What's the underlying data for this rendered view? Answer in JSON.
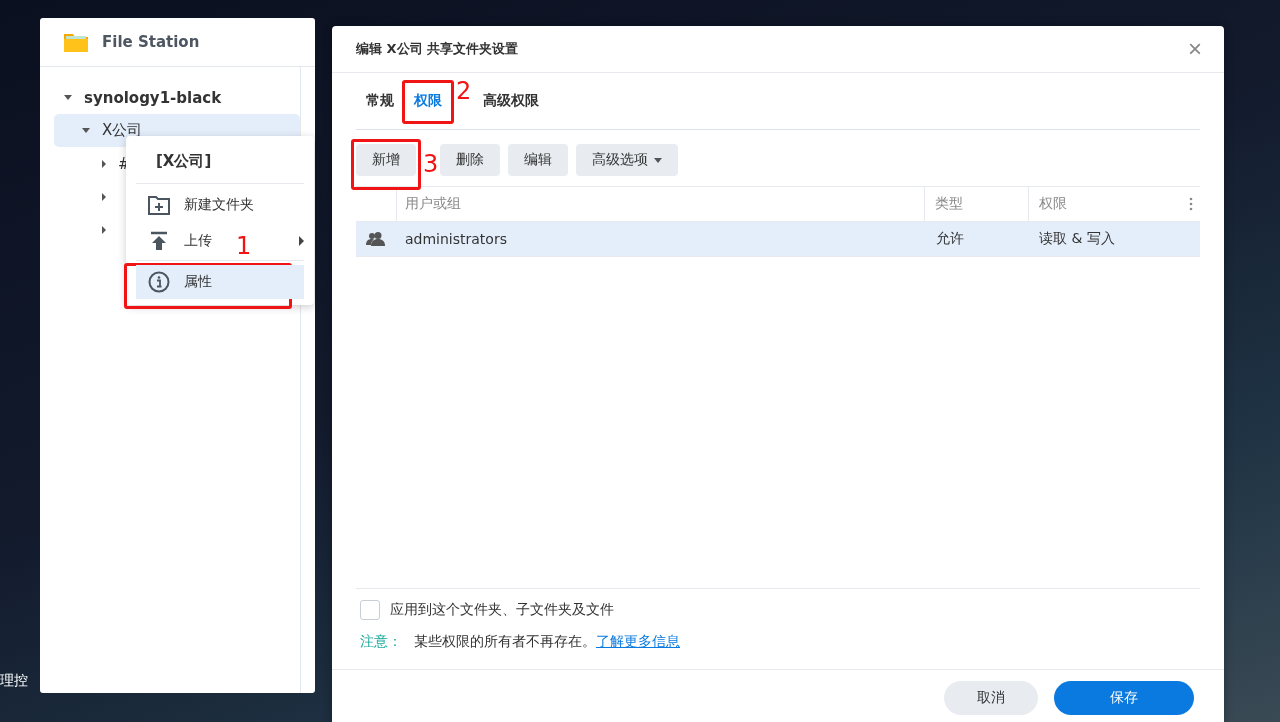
{
  "desktop": {
    "label": "理控"
  },
  "file_station": {
    "title": "File Station",
    "tree": [
      {
        "label": "synology1-black",
        "expanded": true,
        "selected": false,
        "children": [
          {
            "label": "X公司",
            "expanded": true,
            "selected": true,
            "children": [
              {
                "label": "#",
                "expanded": false,
                "selected": false
              },
              {
                "expanded": false,
                "selected": false
              },
              {
                "expanded": false,
                "selected": false
              }
            ]
          }
        ]
      }
    ]
  },
  "context_menu": {
    "title": "[X公司]",
    "items": [
      {
        "kind": "new-folder",
        "label": "新建文件夹",
        "submenu": false,
        "selected": false
      },
      {
        "kind": "upload",
        "label": "上传",
        "submenu": true,
        "selected": false
      },
      {
        "kind": "properties",
        "label": "属性",
        "submenu": false,
        "selected": true
      }
    ]
  },
  "dialog": {
    "title": "编辑 X公司 共享文件夹设置",
    "close": "×",
    "tabs": [
      {
        "label": "常规",
        "selected": false
      },
      {
        "label": "权限",
        "selected": true
      },
      {
        "label": "高级权限",
        "selected": false
      }
    ],
    "toolbar": [
      {
        "label": "新增",
        "dropdown": false
      },
      {
        "label": "删除",
        "dropdown": false
      },
      {
        "label": "编辑",
        "dropdown": false
      },
      {
        "label": "高级选项",
        "dropdown": true
      }
    ],
    "table": {
      "columns": [
        "用户或组",
        "类型",
        "权限"
      ],
      "rows": [
        {
          "user": "administrators",
          "type": "允许",
          "permission": "读取 & 写入",
          "selected": true
        }
      ]
    },
    "apply_checkbox": {
      "label": "应用到这个文件夹、子文件夹及文件",
      "checked": false
    },
    "note": {
      "label": "注意：",
      "text": "某些权限的所有者不再存在。",
      "link": "了解更多信息"
    },
    "buttons": [
      {
        "label": "取消",
        "primary": false
      },
      {
        "label": "保存",
        "primary": true
      }
    ]
  },
  "annotations": [
    {
      "label": "1"
    },
    {
      "label": "2"
    },
    {
      "label": "3"
    }
  ]
}
